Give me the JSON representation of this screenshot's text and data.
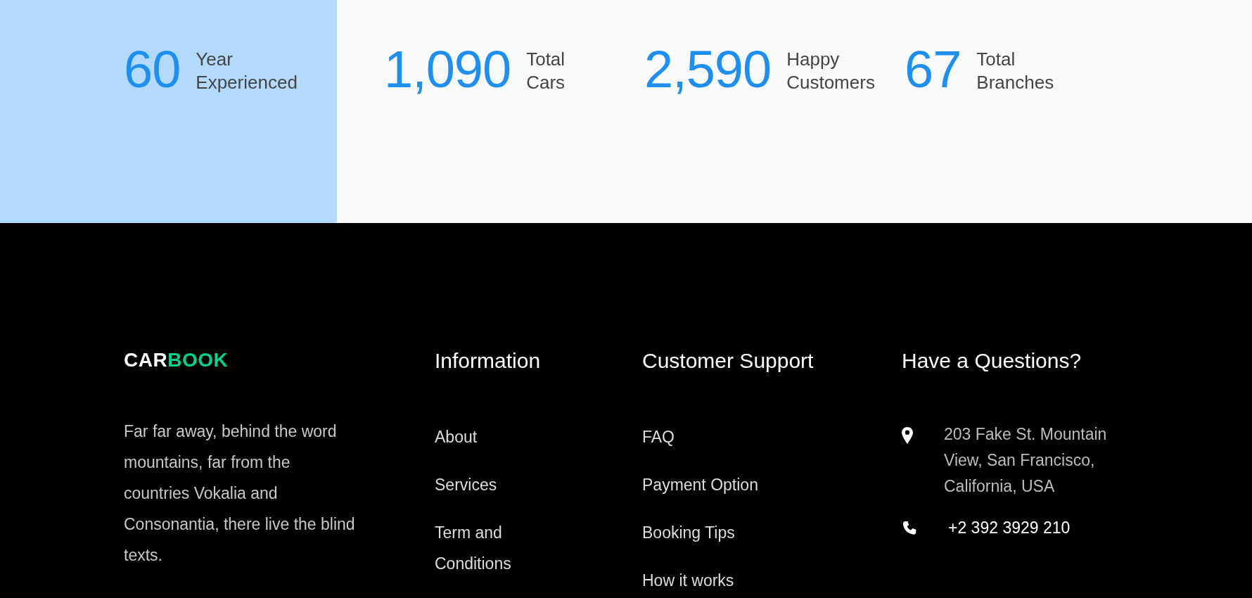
{
  "stats": [
    {
      "number": "60",
      "label_lines": [
        "Year",
        "Experienced"
      ]
    },
    {
      "number": "1,090",
      "label_lines": [
        "Total",
        "Cars"
      ]
    },
    {
      "number": "2,590",
      "label_lines": [
        "Happy",
        "Customers"
      ]
    },
    {
      "number": "67",
      "label_lines": [
        "Total",
        "Branches"
      ]
    }
  ],
  "footer": {
    "logo": [
      {
        "text": "CAR",
        "color": "#ffffff"
      },
      {
        "text": "BOOK",
        "color": "#01d28e"
      }
    ],
    "about": "Far far away, behind the word mountains, far from the countries Vokalia and Consonantia, there live the blind texts.",
    "columns": [
      {
        "heading": "Information",
        "links": [
          "About",
          "Services",
          "Term and Conditions"
        ]
      },
      {
        "heading": "Customer Support",
        "links": [
          "FAQ",
          "Payment Option",
          "Booking Tips",
          "How it works"
        ]
      }
    ],
    "contact": {
      "heading": "Have a Questions?",
      "items": [
        {
          "kind": "address",
          "text": "203 Fake St. Mountain View, San Francisco, California, USA"
        },
        {
          "kind": "phone",
          "text": "+2 392 3929 210"
        }
      ]
    }
  }
}
